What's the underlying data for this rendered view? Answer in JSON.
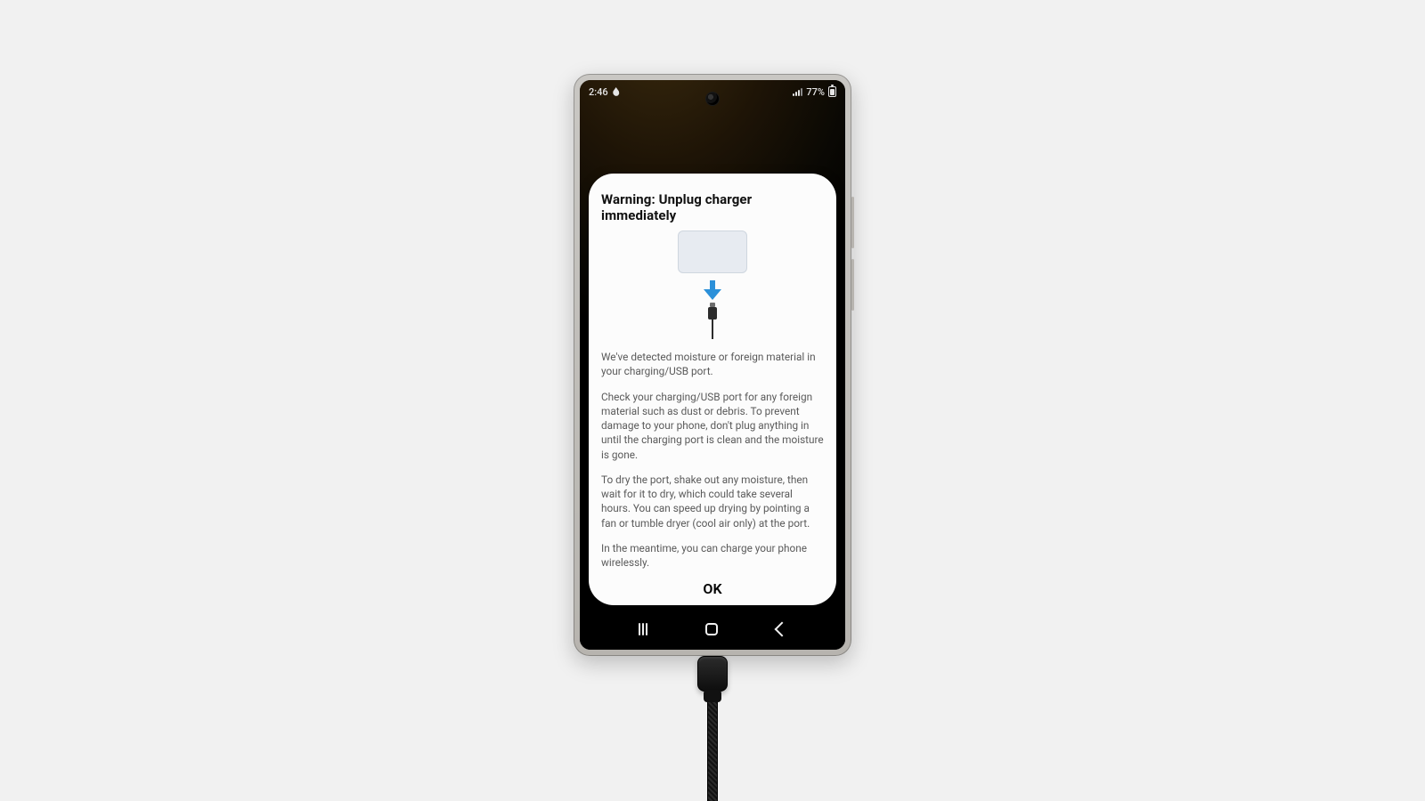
{
  "status": {
    "time": "2:46",
    "battery_percent": "77%"
  },
  "dialog": {
    "title": "Warning: Unplug charger immediately",
    "p1": "We've detected moisture or foreign material in your charging/USB port.",
    "p2": "Check your charging/USB port for any foreign material such as dust or debris. To prevent damage to your phone, don't plug anything in until the charging port is clean and the moisture is gone.",
    "p3": "To dry the port, shake out any moisture, then wait for it to dry, which could take several hours. You can speed up drying by pointing a fan or tumble dryer (cool air only) at the port.",
    "p4": "In the meantime, you can charge your phone wirelessly.",
    "ok_label": "OK"
  },
  "colors": {
    "arrow": "#2b90d9"
  }
}
